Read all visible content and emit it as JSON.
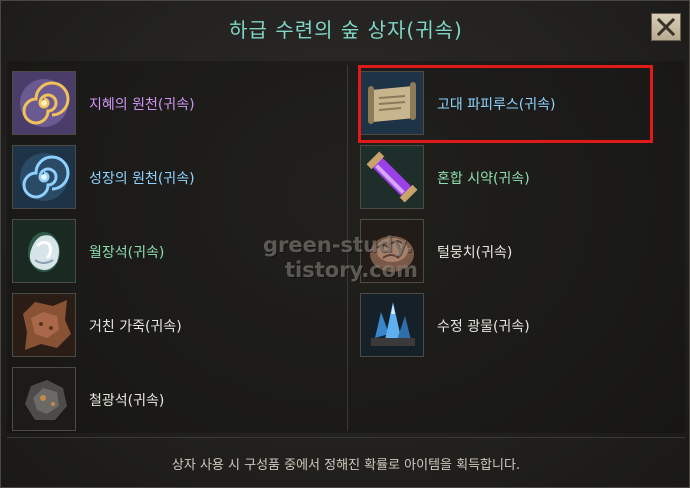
{
  "window": {
    "title": "하급 수련의 숲 상자(귀속)"
  },
  "items_left": [
    {
      "label": "지혜의 원천(귀속)",
      "icon": "wisdom-swirl-icon",
      "color": "#cf95f2"
    },
    {
      "label": "성장의 원천(귀속)",
      "icon": "growth-swirl-icon",
      "color": "#8fd3ff"
    },
    {
      "label": "월장석(귀속)",
      "icon": "moonstone-icon",
      "color": "#8edfb0"
    },
    {
      "label": "거친 가죽(귀속)",
      "icon": "rough-leather-icon",
      "color": "#e9e6df"
    },
    {
      "label": "철광석(귀속)",
      "icon": "iron-ore-icon",
      "color": "#e9e6df"
    }
  ],
  "items_right": [
    {
      "label": "고대 파피루스(귀속)",
      "icon": "papyrus-scroll-icon",
      "color": "#8fd3ff"
    },
    {
      "label": "혼합 시약(귀속)",
      "icon": "reagent-vial-icon",
      "color": "#8edfb0"
    },
    {
      "label": "털뭉치(귀속)",
      "icon": "fur-bundle-icon",
      "color": "#e9e6df"
    },
    {
      "label": "수정 광물(귀속)",
      "icon": "crystal-ore-icon",
      "color": "#e9e6df"
    }
  ],
  "watermark": {
    "line1": "green-study.",
    "line2": "tistory.com"
  },
  "footer": {
    "text": "상자 사용 시 구성품 중에서 정해진 확률로 아이템을 획득합니다."
  }
}
